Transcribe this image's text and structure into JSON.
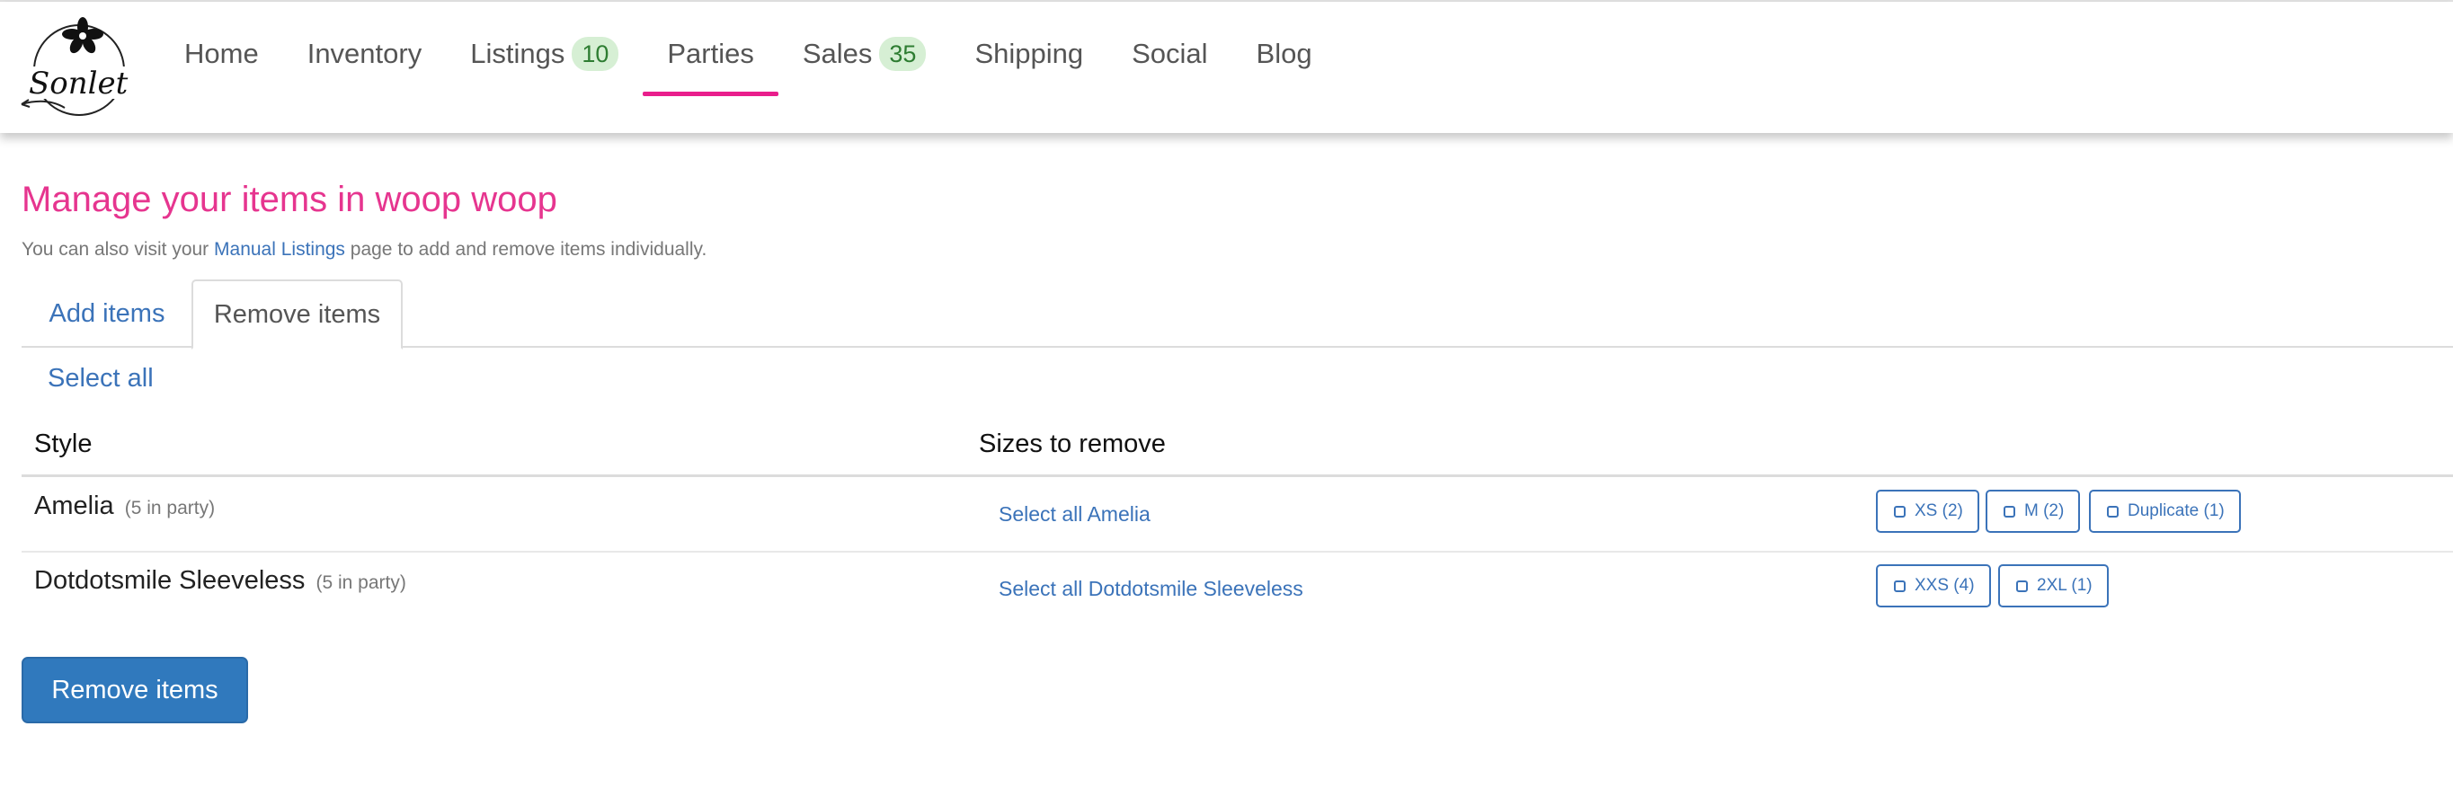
{
  "brand": {
    "logo_text": "Sonlet"
  },
  "nav": {
    "items": [
      {
        "label": "Home"
      },
      {
        "label": "Inventory"
      },
      {
        "label": "Listings",
        "badge": "10"
      },
      {
        "label": "Parties",
        "active": true
      },
      {
        "label": "Sales",
        "badge": "35"
      },
      {
        "label": "Shipping"
      },
      {
        "label": "Social"
      },
      {
        "label": "Blog"
      }
    ]
  },
  "header": {
    "title": "Manage your items in woop woop",
    "subtitle_prefix": "You can also visit your ",
    "subtitle_link": "Manual Listings",
    "subtitle_suffix": " page to add and remove items individually."
  },
  "tabs": [
    {
      "label": "Add items",
      "active": false
    },
    {
      "label": "Remove items",
      "active": true
    }
  ],
  "select_all_label": "Select all",
  "table": {
    "columns": [
      "Style",
      "Sizes to remove"
    ],
    "rows": [
      {
        "name": "Amelia",
        "count_text": "(5 in party)",
        "select_all": "Select all Amelia",
        "sizes": [
          "XS (2)",
          "M (2)",
          "Duplicate (1)"
        ]
      },
      {
        "name": "Dotdotsmile Sleeveless",
        "count_text": "(5 in party)",
        "select_all": "Select all Dotdotsmile Sleeveless",
        "sizes": [
          "XXS (4)",
          "2XL (1)"
        ]
      }
    ]
  },
  "actions": {
    "remove_button": "Remove items"
  },
  "colors": {
    "accent_pink": "#e6358f",
    "nav_underline": "#e91e8c",
    "link_blue": "#3b73b9",
    "button_blue": "#3079bd",
    "badge_green_bg": "#d6efd4"
  }
}
